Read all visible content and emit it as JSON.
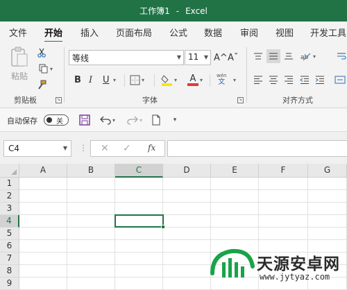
{
  "title": {
    "doc": "工作簿1",
    "sep": "-",
    "app": "Excel"
  },
  "tabs": [
    {
      "label": "文件",
      "active": false
    },
    {
      "label": "开始",
      "active": true
    },
    {
      "label": "插入",
      "active": false
    },
    {
      "label": "页面布局",
      "active": false
    },
    {
      "label": "公式",
      "active": false
    },
    {
      "label": "数据",
      "active": false
    },
    {
      "label": "审阅",
      "active": false
    },
    {
      "label": "视图",
      "active": false
    },
    {
      "label": "开发工具",
      "active": false
    }
  ],
  "ribbon": {
    "clipboard": {
      "paste_label": "粘贴",
      "group_label": "剪贴板"
    },
    "font": {
      "font_name": "等线",
      "font_size": "11",
      "grow_label": "A^",
      "shrink_label": "Aˇ",
      "bold": "B",
      "italic": "I",
      "underline": "U",
      "font_color_letter": "A",
      "phonetic_top": "wén",
      "phonetic_bottom": "文",
      "group_label": "字体"
    },
    "alignment": {
      "group_label": "对齐方式"
    }
  },
  "qat": {
    "autosave_label": "自动保存",
    "autosave_state": "关"
  },
  "formula_bar": {
    "name_box": "C4",
    "fx_label": "fx",
    "formula": ""
  },
  "grid": {
    "columns": [
      "A",
      "B",
      "C",
      "D",
      "E",
      "F",
      "G"
    ],
    "rows": [
      "1",
      "2",
      "3",
      "4",
      "5",
      "6",
      "7",
      "8",
      "9"
    ],
    "active_column": "C",
    "active_row": "4"
  },
  "watermark": {
    "title": "天源安卓网",
    "url": "www.jytyaz.com"
  },
  "colors": {
    "accent": "#217346",
    "fill_yellow": "#ffe600",
    "font_red": "#e03a3a"
  }
}
